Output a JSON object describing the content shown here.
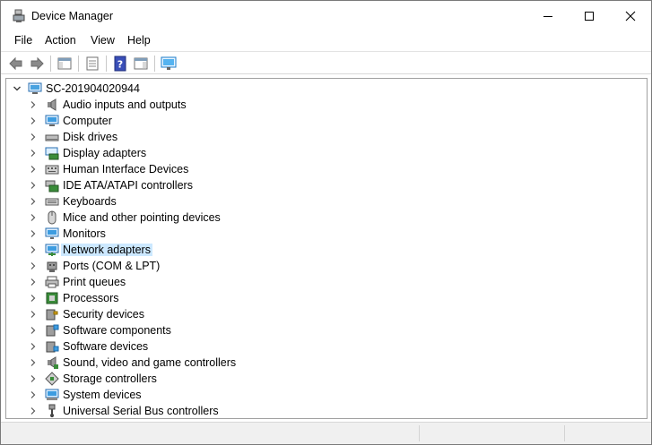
{
  "window": {
    "title": "Device Manager"
  },
  "menu": {
    "items": [
      "File",
      "Action",
      "View",
      "Help"
    ]
  },
  "toolbar": {
    "buttons": [
      "back-icon",
      "forward-icon",
      "show-hide-console-tree-icon",
      "properties-icon",
      "help-icon",
      "action-pane-icon",
      "scan-hardware-icon"
    ]
  },
  "tree": {
    "root": "SC-201904020944",
    "selected_index": 9,
    "items": [
      {
        "label": "Audio inputs and outputs",
        "icon": "speaker-icon"
      },
      {
        "label": "Computer",
        "icon": "computer-icon"
      },
      {
        "label": "Disk drives",
        "icon": "disk-drive-icon"
      },
      {
        "label": "Display adapters",
        "icon": "display-adapter-icon"
      },
      {
        "label": "Human Interface Devices",
        "icon": "hid-icon"
      },
      {
        "label": "IDE ATA/ATAPI controllers",
        "icon": "ide-controller-icon"
      },
      {
        "label": "Keyboards",
        "icon": "keyboard-icon"
      },
      {
        "label": "Mice and other pointing devices",
        "icon": "mouse-icon"
      },
      {
        "label": "Monitors",
        "icon": "monitor-icon"
      },
      {
        "label": "Network adapters",
        "icon": "network-adapter-icon"
      },
      {
        "label": "Ports (COM & LPT)",
        "icon": "port-icon"
      },
      {
        "label": "Print queues",
        "icon": "printer-icon"
      },
      {
        "label": "Processors",
        "icon": "processor-icon"
      },
      {
        "label": "Security devices",
        "icon": "security-device-icon"
      },
      {
        "label": "Software components",
        "icon": "software-component-icon"
      },
      {
        "label": "Software devices",
        "icon": "software-device-icon"
      },
      {
        "label": "Sound, video and game controllers",
        "icon": "sound-controller-icon"
      },
      {
        "label": "Storage controllers",
        "icon": "storage-controller-icon"
      },
      {
        "label": "System devices",
        "icon": "system-devices-icon"
      },
      {
        "label": "Universal Serial Bus controllers",
        "icon": "usb-icon"
      }
    ]
  }
}
